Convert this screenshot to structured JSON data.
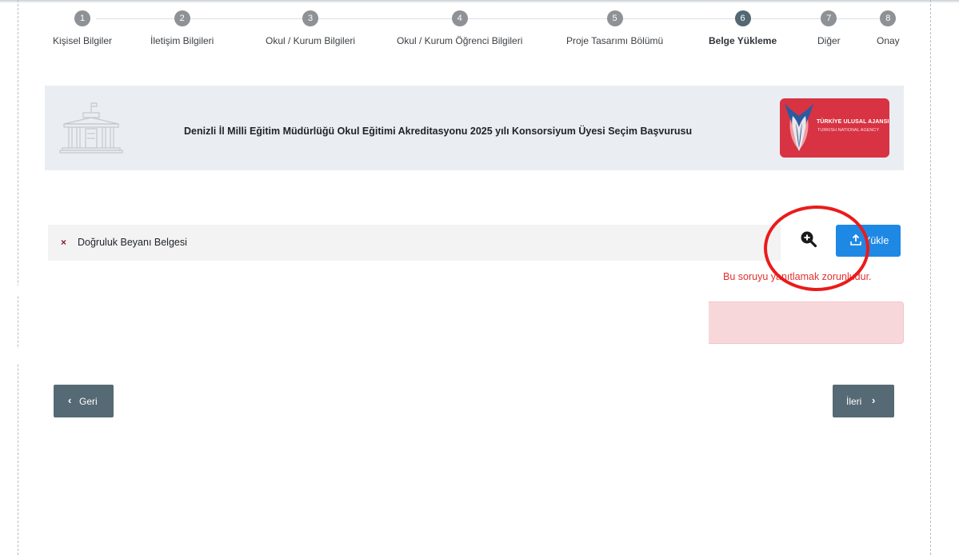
{
  "stepper": {
    "steps": [
      {
        "number": "1",
        "label": "Kişisel Bilgiler"
      },
      {
        "number": "2",
        "label": "İletişim Bilgileri"
      },
      {
        "number": "3",
        "label": "Okul / Kurum Bilgileri"
      },
      {
        "number": "4",
        "label": "Okul / Kurum Öğrenci Bilgileri"
      },
      {
        "number": "5",
        "label": "Proje Tasarımı Bölümü"
      },
      {
        "number": "6",
        "label": "Belge Yükleme"
      },
      {
        "number": "7",
        "label": "Diğer"
      },
      {
        "number": "8",
        "label": "Onay"
      }
    ],
    "active_step": 6
  },
  "banner": {
    "title": "Denizli İl Milli Eğitim Müdürlüğü Okul Eğitimi Akreditasyonu 2025 yılı Konsorsiyum Üyesi Seçim Başvurusu",
    "logo": {
      "line1": "TÜRKİYE ULUSAL AJANSI",
      "line2": "TURKISH NATIONAL AGENCY",
      "background": "#d73343"
    }
  },
  "documents": [
    {
      "status_icon": "x-icon",
      "status_symbol": "×",
      "label": "Doğruluk Beyanı Belgesi"
    }
  ],
  "actions": {
    "preview_icon": "zoom-in-icon",
    "upload_label": "Yükle",
    "upload_icon": "upload-icon"
  },
  "validation": {
    "required_message": "Bu soruyu yanıtlamak zorunludur."
  },
  "navigation": {
    "back_label": "Geri",
    "next_label": "İleri",
    "back_symbol": "‹",
    "next_symbol": "›"
  },
  "colors": {
    "primary": "#1e88e5",
    "nav_button": "#566a75",
    "error_text": "#e0312f",
    "alert_bg": "#f8d7da",
    "highlight": "#ea1b1b"
  }
}
